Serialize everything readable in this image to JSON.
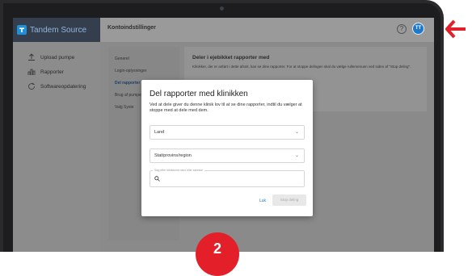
{
  "app": {
    "brand": "Tandem Source",
    "page_title": "Kontoindstillinger",
    "avatar_initials": "TT",
    "help_glyph": "?"
  },
  "sidebar": {
    "items": [
      {
        "label": "Upload pumpe",
        "icon": "upload-icon"
      },
      {
        "label": "Rapporter",
        "icon": "bar-chart-icon"
      },
      {
        "label": "Softwareopdatering",
        "icon": "refresh-icon"
      }
    ]
  },
  "subnav": {
    "items": [
      {
        "label": "Generel"
      },
      {
        "label": "Login-oplysninger"
      },
      {
        "label": "Del rapporter"
      },
      {
        "label": "Brug af pumpe"
      },
      {
        "label": "Valg Syste"
      }
    ],
    "active_index": 2
  },
  "panel": {
    "title": "Deler i ejebikket rapporter med",
    "text": "Klinikker, der er anført i dette afsnit, kan se dine rapporter. For at stoppe delingen skal du vælge rullemenuen ved siden af \"Stop deling\"."
  },
  "modal": {
    "title": "Del rapporter med klinikken",
    "description": "Ved at dele giver du denne klinik lov til at se dine rapporter, indtil du vælger at stoppe med at dele med dem.",
    "country_value": "Land",
    "state_value": "Stat/provins/region",
    "search_label": "Søg efter klinikkens navn eller adresse",
    "close_label": "Luk",
    "stop_label": "Stop deling"
  },
  "step_badge": "2",
  "colors": {
    "brand_blue": "#1f8fd8",
    "badge_red": "#e3202a",
    "arrow_red": "#e3202a",
    "link_blue": "#1f79c9"
  }
}
